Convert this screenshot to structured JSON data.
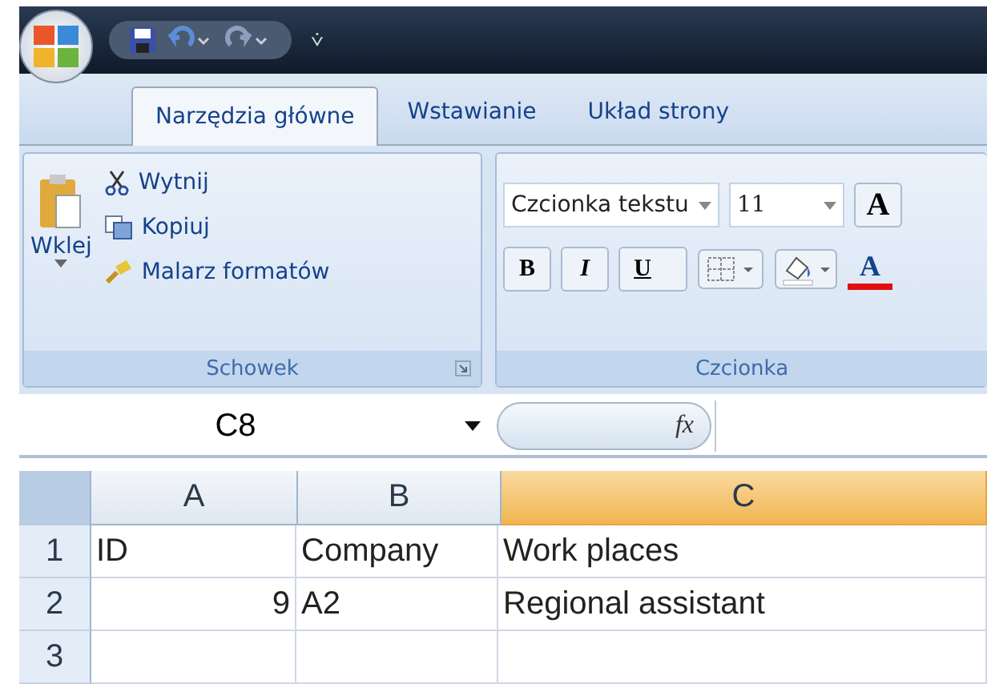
{
  "quick_access": {
    "title_mark": "⩒"
  },
  "tabs": [
    {
      "label": "Narzędzia główne",
      "selected": true
    },
    {
      "label": "Wstawianie",
      "selected": false
    },
    {
      "label": "Układ strony",
      "selected": false
    }
  ],
  "clipboard_group": {
    "paste": "Wklej",
    "items": [
      {
        "kind": "cut",
        "label": "Wytnij"
      },
      {
        "kind": "copy",
        "label": "Kopiuj"
      },
      {
        "kind": "painter",
        "label": "Malarz formatów"
      }
    ],
    "label": "Schowek"
  },
  "font_group": {
    "font_name": "Czcionka tekstu",
    "font_size": "11",
    "grow": "A",
    "bold": "B",
    "italic": "I",
    "underline": "U",
    "font_color": "A",
    "label": "Czcionka"
  },
  "formula_bar": {
    "name_box": "C8",
    "fx": "fx"
  },
  "sheet": {
    "columns": [
      {
        "label": "A",
        "selected": false
      },
      {
        "label": "B",
        "selected": false
      },
      {
        "label": "C",
        "selected": true
      }
    ],
    "rows": [
      {
        "number": "1",
        "cells": [
          "ID",
          "Company",
          "Work places"
        ]
      },
      {
        "number": "2",
        "cells": [
          "9",
          "A2",
          "Regional assistant"
        ]
      },
      {
        "number": "3",
        "cells": []
      }
    ]
  }
}
